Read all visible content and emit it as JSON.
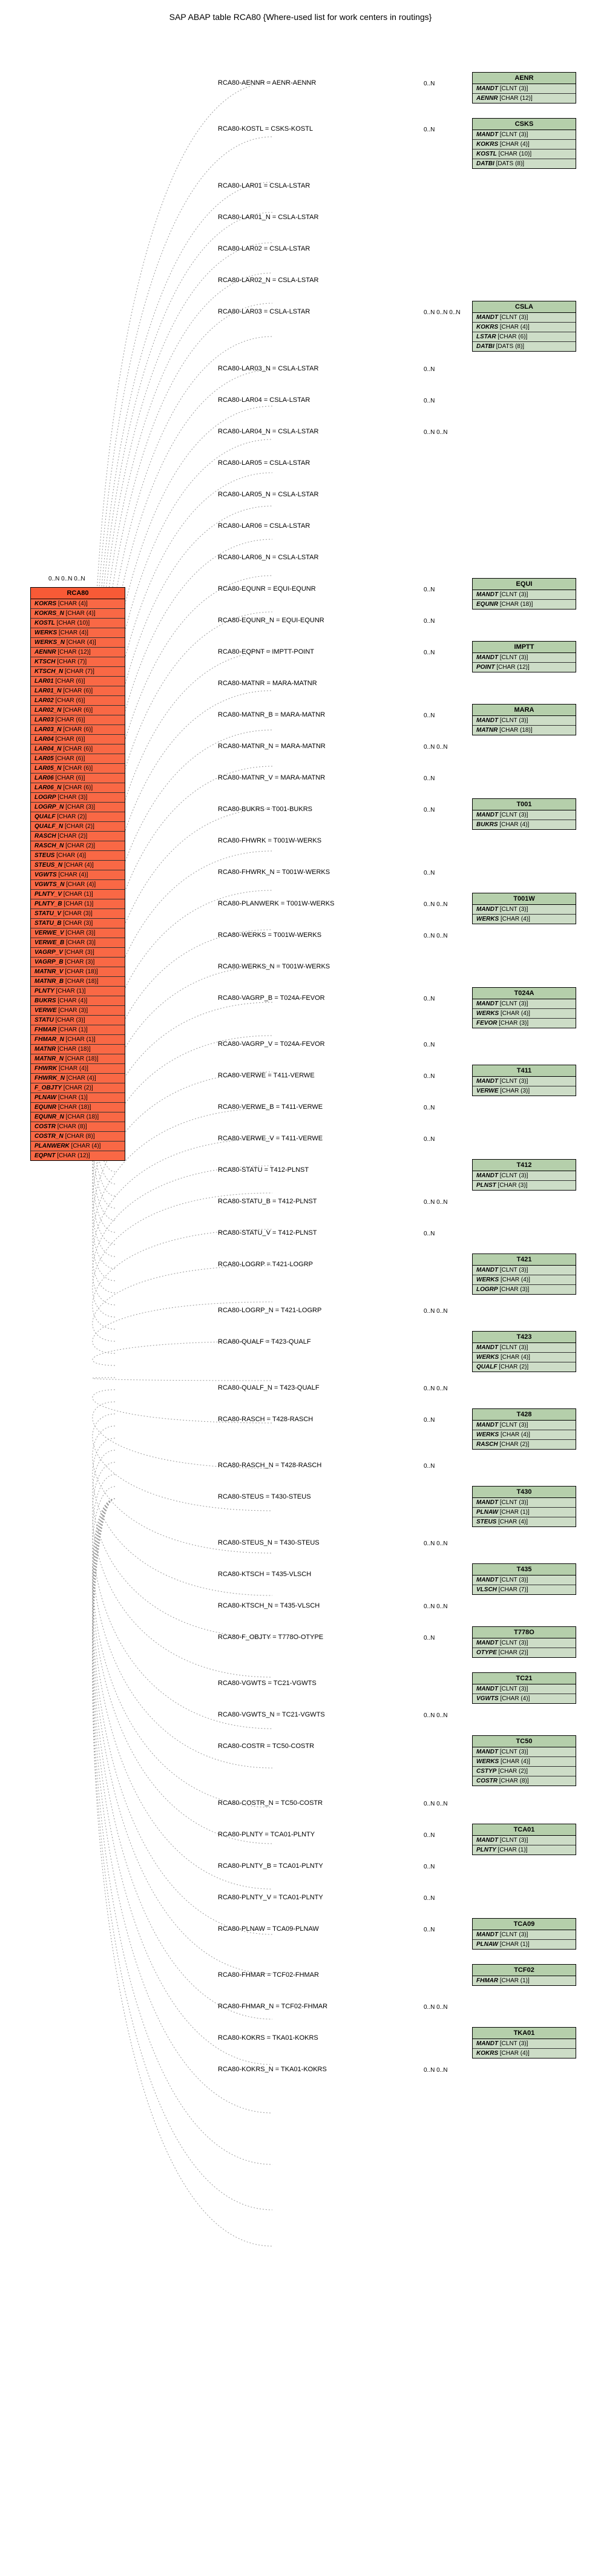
{
  "title": "SAP ABAP table RCA80 {Where-used list for work centers in routings}",
  "main_table": {
    "name": "RCA80",
    "fields": [
      "KOKRS [CHAR (4)]",
      "KOKRS_N [CHAR (4)]",
      "KOSTL [CHAR (10)]",
      "WERKS [CHAR (4)]",
      "WERKS_N [CHAR (4)]",
      "AENNR [CHAR (12)]",
      "KTSCH [CHAR (7)]",
      "KTSCH_N [CHAR (7)]",
      "LAR01 [CHAR (6)]",
      "LAR01_N [CHAR (6)]",
      "LAR02 [CHAR (6)]",
      "LAR02_N [CHAR (6)]",
      "LAR03 [CHAR (6)]",
      "LAR03_N [CHAR (6)]",
      "LAR04 [CHAR (6)]",
      "LAR04_N [CHAR (6)]",
      "LAR05 [CHAR (6)]",
      "LAR05_N [CHAR (6)]",
      "LAR06 [CHAR (6)]",
      "LAR06_N [CHAR (6)]",
      "LOGRP [CHAR (3)]",
      "LOGRP_N [CHAR (3)]",
      "QUALF [CHAR (2)]",
      "QUALF_N [CHAR (2)]",
      "RASCH [CHAR (2)]",
      "RASCH_N [CHAR (2)]",
      "STEUS [CHAR (4)]",
      "STEUS_N [CHAR (4)]",
      "VGWTS [CHAR (4)]",
      "VGWTS_N [CHAR (4)]",
      "PLNTY_V [CHAR (1)]",
      "PLNTY_B [CHAR (1)]",
      "STATU_V [CHAR (3)]",
      "STATU_B [CHAR (3)]",
      "VERWE_V [CHAR (3)]",
      "VERWE_B [CHAR (3)]",
      "VAGRP_V [CHAR (3)]",
      "VAGRP_B [CHAR (3)]",
      "MATNR_V [CHAR (18)]",
      "MATNR_B [CHAR (18)]",
      "PLNTY [CHAR (1)]",
      "BUKRS [CHAR (4)]",
      "VERWE [CHAR (3)]",
      "STATU [CHAR (3)]",
      "FHMAR [CHAR (1)]",
      "FHMAR_N [CHAR (1)]",
      "MATNR [CHAR (18)]",
      "MATNR_N [CHAR (18)]",
      "FHWRK [CHAR (4)]",
      "FHWRK_N [CHAR (4)]",
      "F_OBJTY [CHAR (2)]",
      "PLNAW [CHAR (1)]",
      "EQUNR [CHAR (18)]",
      "EQUNR_N [CHAR (18)]",
      "COSTR [CHAR (8)]",
      "COSTR_N [CHAR (8)]",
      "PLANWERK [CHAR (4)]",
      "EQPNT [CHAR (12)]"
    ]
  },
  "relations": [
    {
      "label": "RCA80-AENNR = AENR-AENNR",
      "target": "AENR",
      "rows": [
        "MANDT [CLNT (3)]",
        "AENNR [CHAR (12)]"
      ],
      "card": "0..N"
    },
    {
      "label": "RCA80-KOSTL = CSKS-KOSTL",
      "target": "CSKS",
      "rows": [
        "MANDT [CLNT (3)]",
        "KOKRS [CHAR (4)]",
        "KOSTL [CHAR (10)]",
        "DATBI [DATS (8)]"
      ],
      "card": "0..N"
    },
    {
      "label": "RCA80-LAR01 = CSLA-LSTAR",
      "target": "",
      "card": ""
    },
    {
      "label": "RCA80-LAR01_N = CSLA-LSTAR",
      "target": "",
      "card": ""
    },
    {
      "label": "RCA80-LAR02 = CSLA-LSTAR",
      "target": "",
      "card": ""
    },
    {
      "label": "RCA80-LAR02_N = CSLA-LSTAR",
      "target": "",
      "card": ""
    },
    {
      "label": "RCA80-LAR03 = CSLA-LSTAR",
      "target": "CSLA",
      "rows": [
        "MANDT [CLNT (3)]",
        "KOKRS [CHAR (4)]",
        "LSTAR [CHAR (6)]",
        "DATBI [DATS (8)]"
      ],
      "card": "0..N 0..N 0..N"
    },
    {
      "label": "RCA80-LAR03_N = CSLA-LSTAR",
      "target": "",
      "card": "0..N"
    },
    {
      "label": "RCA80-LAR04 = CSLA-LSTAR",
      "target": "",
      "card": "0..N"
    },
    {
      "label": "RCA80-LAR04_N = CSLA-LSTAR",
      "target": "",
      "card": "0..N 0..N"
    },
    {
      "label": "RCA80-LAR05 = CSLA-LSTAR",
      "target": "",
      "card": ""
    },
    {
      "label": "RCA80-LAR05_N = CSLA-LSTAR",
      "target": "",
      "card": ""
    },
    {
      "label": "RCA80-LAR06 = CSLA-LSTAR",
      "target": "",
      "card": ""
    },
    {
      "label": "RCA80-LAR06_N = CSLA-LSTAR",
      "target": "",
      "card": ""
    },
    {
      "label": "RCA80-EQUNR = EQUI-EQUNR",
      "target": "EQUI",
      "rows": [
        "MANDT [CLNT (3)]",
        "EQUNR [CHAR (18)]"
      ],
      "card": "0..N"
    },
    {
      "label": "RCA80-EQUNR_N = EQUI-EQUNR",
      "target": "",
      "card": "0..N"
    },
    {
      "label": "RCA80-EQPNT = IMPTT-POINT",
      "target": "IMPTT",
      "rows": [
        "MANDT [CLNT (3)]",
        "POINT [CHAR (12)]"
      ],
      "card": "0..N"
    },
    {
      "label": "RCA80-MATNR = MARA-MATNR",
      "target": "",
      "card": ""
    },
    {
      "label": "RCA80-MATNR_B = MARA-MATNR",
      "target": "MARA",
      "rows": [
        "MANDT [CLNT (3)]",
        "MATNR [CHAR (18)]"
      ],
      "card": "0..N"
    },
    {
      "label": "RCA80-MATNR_N = MARA-MATNR",
      "target": "",
      "card": "0..N 0..N"
    },
    {
      "label": "RCA80-MATNR_V = MARA-MATNR",
      "target": "",
      "card": "0..N"
    },
    {
      "label": "RCA80-BUKRS = T001-BUKRS",
      "target": "T001",
      "rows": [
        "MANDT [CLNT (3)]",
        "BUKRS [CHAR (4)]"
      ],
      "card": "0..N"
    },
    {
      "label": "RCA80-FHWRK = T001W-WERKS",
      "target": "",
      "card": ""
    },
    {
      "label": "RCA80-FHWRK_N = T001W-WERKS",
      "target": "",
      "card": "0..N"
    },
    {
      "label": "RCA80-PLANWERK = T001W-WERKS",
      "target": "T001W",
      "rows": [
        "MANDT [CLNT (3)]",
        "WERKS [CHAR (4)]"
      ],
      "card": "0..N 0..N"
    },
    {
      "label": "RCA80-WERKS = T001W-WERKS",
      "target": "",
      "card": "0..N 0..N"
    },
    {
      "label": "RCA80-WERKS_N = T001W-WERKS",
      "target": "",
      "card": ""
    },
    {
      "label": "RCA80-VAGRP_B = T024A-FEVOR",
      "target": "T024A",
      "rows": [
        "MANDT [CLNT (3)]",
        "WERKS [CHAR (4)]",
        "FEVOR [CHAR (3)]"
      ],
      "card": "0..N"
    },
    {
      "label": "RCA80-VAGRP_V = T024A-FEVOR",
      "target": "",
      "card": "0..N"
    },
    {
      "label": "RCA80-VERWE = T411-VERWE",
      "target": "T411",
      "rows": [
        "MANDT [CLNT (3)]",
        "VERWE [CHAR (3)]"
      ],
      "card": "0..N"
    },
    {
      "label": "RCA80-VERWE_B = T411-VERWE",
      "target": "",
      "card": "0..N"
    },
    {
      "label": "RCA80-VERWE_V = T411-VERWE",
      "target": "",
      "card": "0..N"
    },
    {
      "label": "RCA80-STATU = T412-PLNST",
      "target": "T412",
      "rows": [
        "MANDT [CLNT (3)]",
        "PLNST [CHAR (3)]"
      ],
      "card": ""
    },
    {
      "label": "RCA80-STATU_B = T412-PLNST",
      "target": "",
      "card": "0..N 0..N"
    },
    {
      "label": "RCA80-STATU_V = T412-PLNST",
      "target": "",
      "card": "0..N"
    },
    {
      "label": "RCA80-LOGRP = T421-LOGRP",
      "target": "T421",
      "rows": [
        "MANDT [CLNT (3)]",
        "WERKS [CHAR (4)]",
        "LOGRP [CHAR (3)]"
      ],
      "card": ""
    },
    {
      "label": "RCA80-LOGRP_N = T421-LOGRP",
      "target": "",
      "card": "0..N 0..N"
    },
    {
      "label": "RCA80-QUALF = T423-QUALF",
      "target": "T423",
      "rows": [
        "MANDT [CLNT (3)]",
        "WERKS [CHAR (4)]",
        "QUALF [CHAR (2)]"
      ],
      "card": ""
    },
    {
      "label": "RCA80-QUALF_N = T423-QUALF",
      "target": "",
      "card": "0..N 0..N"
    },
    {
      "label": "RCA80-RASCH = T428-RASCH",
      "target": "T428",
      "rows": [
        "MANDT [CLNT (3)]",
        "WERKS [CHAR (4)]",
        "RASCH [CHAR (2)]"
      ],
      "card": "0..N"
    },
    {
      "label": "RCA80-RASCH_N = T428-RASCH",
      "target": "",
      "card": "0..N"
    },
    {
      "label": "RCA80-STEUS = T430-STEUS",
      "target": "T430",
      "rows": [
        "MANDT [CLNT (3)]",
        "PLNAW [CHAR (1)]",
        "STEUS [CHAR (4)]"
      ],
      "card": ""
    },
    {
      "label": "RCA80-STEUS_N = T430-STEUS",
      "target": "",
      "card": "0..N 0..N"
    },
    {
      "label": "RCA80-KTSCH = T435-VLSCH",
      "target": "T435",
      "rows": [
        "MANDT [CLNT (3)]",
        "VLSCH [CHAR (7)]"
      ],
      "card": ""
    },
    {
      "label": "RCA80-KTSCH_N = T435-VLSCH",
      "target": "",
      "card": "0..N 0..N"
    },
    {
      "label": "RCA80-F_OBJTY = T778O-OTYPE",
      "target": "T778O",
      "rows": [
        "MANDT [CLNT (3)]",
        "OTYPE [CHAR (2)]"
      ],
      "card": "0..N"
    },
    {
      "label": "RCA80-VGWTS = TC21-VGWTS",
      "target": "TC21",
      "rows": [
        "MANDT [CLNT (3)]",
        "VGWTS [CHAR (4)]"
      ],
      "card": ""
    },
    {
      "label": "RCA80-VGWTS_N = TC21-VGWTS",
      "target": "",
      "card": "0..N 0..N"
    },
    {
      "label": "RCA80-COSTR = TC50-COSTR",
      "target": "TC50",
      "rows": [
        "MANDT [CLNT (3)]",
        "WERKS [CHAR (4)]",
        "CSTYP [CHAR (2)]",
        "COSTR [CHAR (8)]"
      ],
      "card": ""
    },
    {
      "label": "RCA80-COSTR_N = TC50-COSTR",
      "target": "",
      "card": "0..N 0..N"
    },
    {
      "label": "RCA80-PLNTY = TCA01-PLNTY",
      "target": "TCA01",
      "rows": [
        "MANDT [CLNT (3)]",
        "PLNTY [CHAR (1)]"
      ],
      "card": "0..N"
    },
    {
      "label": "RCA80-PLNTY_B = TCA01-PLNTY",
      "target": "",
      "card": "0..N"
    },
    {
      "label": "RCA80-PLNTY_V = TCA01-PLNTY",
      "target": "",
      "card": "0..N"
    },
    {
      "label": "RCA80-PLNAW = TCA09-PLNAW",
      "target": "TCA09",
      "rows": [
        "MANDT [CLNT (3)]",
        "PLNAW [CHAR (1)]"
      ],
      "card": "0..N"
    },
    {
      "label": "RCA80-FHMAR = TCF02-FHMAR",
      "target": "TCF02",
      "rows": [
        "FHMAR [CHAR (1)]"
      ],
      "card": ""
    },
    {
      "label": "RCA80-FHMAR_N = TCF02-FHMAR",
      "target": "",
      "card": "0..N 0..N"
    },
    {
      "label": "RCA80-KOKRS = TKA01-KOKRS",
      "target": "TKA01",
      "rows": [
        "MANDT [CLNT (3)]",
        "KOKRS [CHAR (4)]"
      ],
      "card": ""
    },
    {
      "label": "RCA80-KOKRS_N = TKA01-KOKRS",
      "target": "",
      "card": "0..N 0..N"
    }
  ],
  "left_cards": "0..N 0..N 0..N"
}
